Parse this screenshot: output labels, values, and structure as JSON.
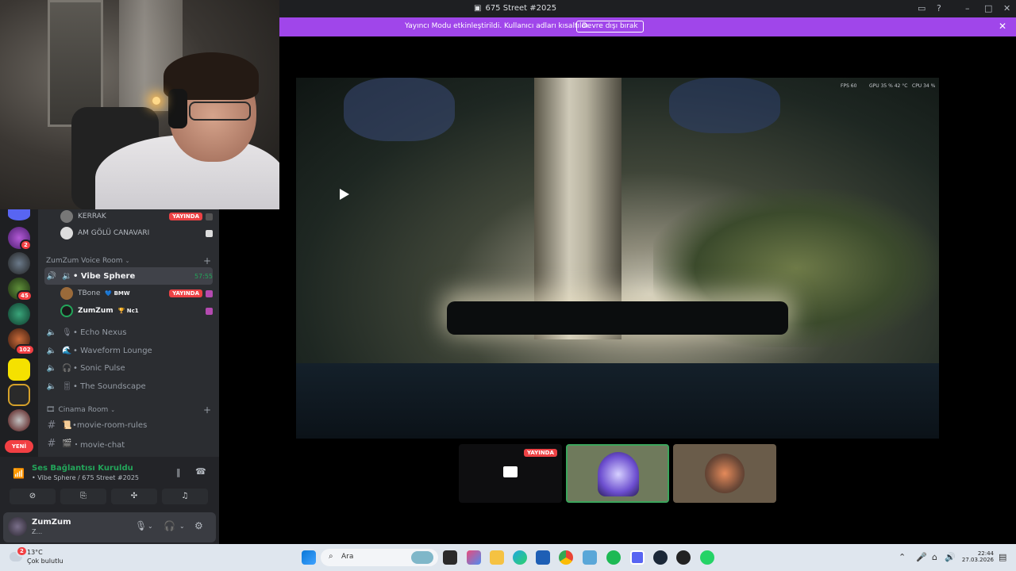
{
  "window": {
    "title": "675 Street #2025"
  },
  "banner": {
    "message": "Yayıncı Modu etkinleştirildi. Kullanıcı adları kısaltıldı.",
    "button": "Devre dışı bırak"
  },
  "servers": {
    "badges": [
      "2",
      "45",
      "102"
    ],
    "new_label": "YENİ"
  },
  "channels": {
    "top_users": [
      {
        "name": "KERRAK",
        "live": "YAYINDA"
      },
      {
        "name": "AM GÖLÜ CANAVARI",
        "live": ""
      }
    ],
    "voice_category": "ZumZum Voice Room",
    "active_channel": {
      "name": "• Vibe Sphere",
      "timer": "57:55"
    },
    "active_users": [
      {
        "name": "TBone",
        "tag": "BMW",
        "live": "YAYINDA"
      },
      {
        "name": "ZumZum",
        "tag": "Nc1",
        "live": ""
      }
    ],
    "voice_channels": [
      "• Echo Nexus",
      "• Waveform Lounge",
      "• Sonic Pulse",
      "• The Soundscape"
    ],
    "cinema_category": "Cinama Room",
    "text_channels": [
      "•movie-room-rules",
      "・movie-chat"
    ]
  },
  "voice": {
    "status": "Ses Bağlantısı Kuruldu",
    "location": "• Vibe Sphere / 675 Street #2025"
  },
  "user": {
    "name": "ZumZum",
    "status": "Z..."
  },
  "stream": {
    "perf_fps": "FPS  60",
    "perf_gpu": "GPU  35 %  42 °C",
    "perf_cpu": "CPU  34 %",
    "tile_live": "YAYINDA"
  },
  "taskbar": {
    "temperature": "13°C",
    "condition": "Çok bulutlu",
    "weather_badge": "2",
    "search_placeholder": "Ara",
    "time": "22:44",
    "date": "27.03.2026"
  },
  "colors": {
    "accent_purple": "#a046ea",
    "live_red": "#ed4245",
    "connected_green": "#23a55a"
  }
}
